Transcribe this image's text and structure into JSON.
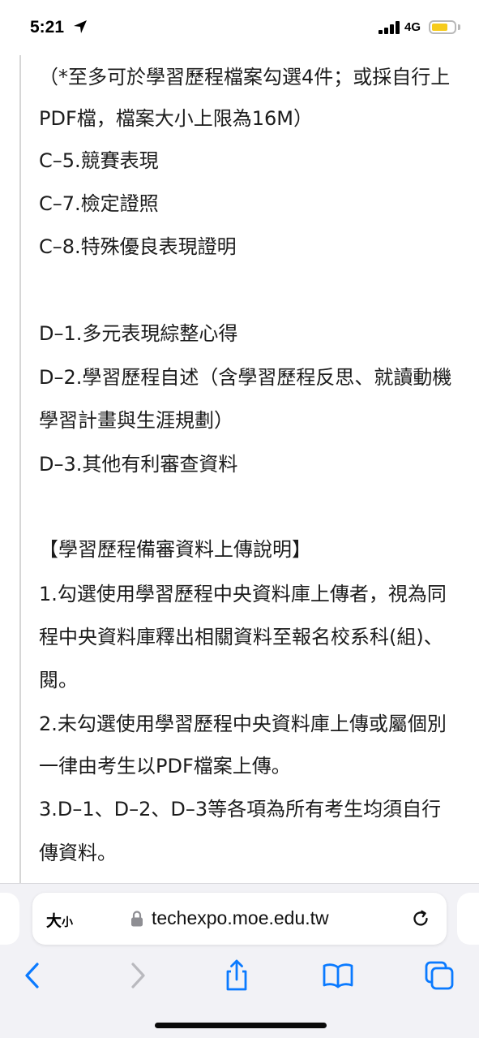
{
  "status_bar": {
    "time": "5:21",
    "network": "4G",
    "battery_color": "#f6cb1c"
  },
  "article": {
    "lines": [
      "（*至多可於學習歷程檔案勾選4件；或採自行上",
      "PDF檔，檔案大小上限為16M）",
      "C–5.競賽表現",
      "C–7.檢定證照",
      "C–8.特殊優良表現證明",
      "D–1.多元表現綜整心得",
      "D–2.學習歷程自述（含學習歷程反思、就讀動機",
      "學習計畫與生涯規劃）",
      "D–3.其他有利審查資料",
      "【學習歷程備審資料上傳說明】",
      "1.勾選使用學習歷程中央資料庫上傳者，視為同",
      "程中央資料庫釋出相關資料至報名校系科(組)、",
      "閱。",
      "2.未勾選使用學習歷程中央資料庫上傳或屬個別",
      "一律由考生以PDF檔案上傳。",
      "3.D–1、D–2、D–3等各項為所有考生均須自行",
      "傳資料。"
    ]
  },
  "browser": {
    "text_size_label_big": "大",
    "text_size_label_small": "小",
    "url": "techexpo.moe.edu.tw",
    "icons": [
      "location-arrow-icon",
      "signal-icon",
      "battery-icon",
      "lock-icon",
      "reload-icon",
      "back-icon",
      "forward-icon",
      "share-icon",
      "bookmarks-icon",
      "tabs-icon"
    ],
    "accent_color": "#0a7aff",
    "disabled_color": "#b9b9be"
  }
}
